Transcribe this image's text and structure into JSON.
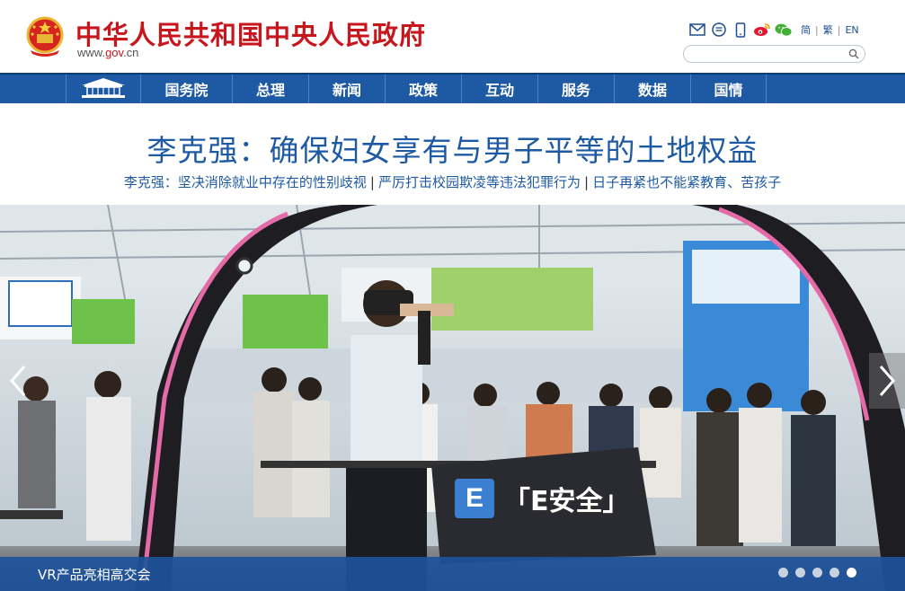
{
  "header": {
    "title": "中华人民共和国中央人民政府",
    "url_prefix": "www.",
    "url_highlight": "gov",
    "url_suffix": ".cn",
    "tool_icons": [
      "mail-icon",
      "message-icon",
      "mobile-icon",
      "weibo-icon",
      "wechat-icon"
    ],
    "lang_simplified": "简",
    "lang_traditional": "繁",
    "lang_english": "EN",
    "lang_sep": "|",
    "search_placeholder": ""
  },
  "nav": {
    "home_icon": "building-icon",
    "items": [
      "国务院",
      "总理",
      "新闻",
      "政策",
      "互动",
      "服务",
      "数据",
      "国情"
    ]
  },
  "headline": {
    "title": "李克强：确保妇女享有与男子平等的土地权益",
    "sub_items": [
      "李克强：坚决消除就业中存在的性别歧视",
      "严厉打击校园欺凌等违法犯罪行为",
      "日子再紧也不能紧教育、苦孩子"
    ],
    "sep": "|"
  },
  "carousel": {
    "caption": "VR产品亮相高交会",
    "watermark_logo": "E",
    "watermark_text": "「E安全」",
    "dots": 5,
    "active_dot": 4
  },
  "colors": {
    "brand_red": "#c8161d",
    "nav_blue": "#1d5aa3",
    "caption_blue": "#1d529b"
  }
}
